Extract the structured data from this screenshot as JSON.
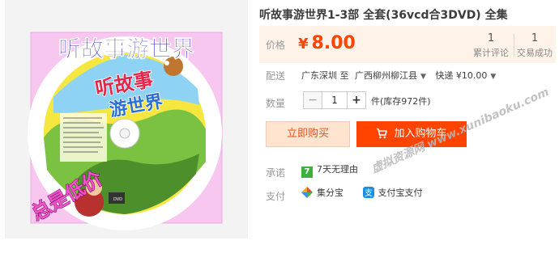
{
  "product": {
    "title": "听故事游世界1-3部 全套(36vcd合3DVD) 全集",
    "image": {
      "cover_title": "听故事游世界",
      "disc_title": "听故事游世界",
      "stamp_text": "总是低价"
    }
  },
  "price": {
    "label": "价格",
    "currency": "¥",
    "value": "8.00"
  },
  "stats": {
    "reviews": {
      "count": "1",
      "label": "累计评论"
    },
    "sales": {
      "count": "1",
      "label": "交易成功"
    }
  },
  "shipping": {
    "label": "配送",
    "from": "广东深圳 至",
    "to": "广西柳州柳江县",
    "method": "快递 ¥10.00"
  },
  "quantity": {
    "label": "数量",
    "minus": "−",
    "value": "1",
    "plus": "+",
    "stock_text": "件(库存972件)"
  },
  "buttons": {
    "buy_now": "立即购买",
    "add_to_cart": "加入购物车"
  },
  "promise": {
    "label": "承诺",
    "badge": "7",
    "text": "7天无理由"
  },
  "payment": {
    "label": "支付",
    "methods": [
      "集分宝",
      "支付宝支付"
    ]
  },
  "watermark": "虚拟资源网 www.xunibaoku.com",
  "colors": {
    "accent": "#ff4400",
    "buy_bg": "#ffe4d0",
    "price_bg": "#fff2e8",
    "badge_green": "#3cb13c"
  }
}
